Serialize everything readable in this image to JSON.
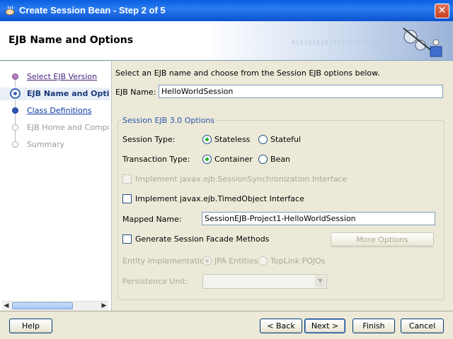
{
  "window": {
    "title": "Create Session Bean - Step 2 of 5"
  },
  "header": {
    "title": "EJB Name and Options",
    "binary_deco": "0101010101010101010101"
  },
  "steps": [
    {
      "label": "Select EJB Version",
      "state": "done"
    },
    {
      "label": "EJB Name and Options",
      "state": "current"
    },
    {
      "label": "Class Definitions",
      "state": "next"
    },
    {
      "label": "EJB Home and Component Interfaces",
      "state": "disabled"
    },
    {
      "label": "Summary",
      "state": "disabled"
    }
  ],
  "main": {
    "instructions": "Select an EJB name and choose from the Session EJB options below.",
    "ejb_name_label": "EJB Name:",
    "ejb_name_value": "HelloWorldSession",
    "group_title": "Session EJB 3.0 Options",
    "session_type_label": "Session Type:",
    "session_type_options": [
      "Stateless",
      "Stateful"
    ],
    "session_type_selected": "Stateless",
    "transaction_type_label": "Transaction Type:",
    "transaction_type_options": [
      "Container",
      "Bean"
    ],
    "transaction_type_selected": "Container",
    "implement_sync_label": "Implement javax.ejb.SessionSynchronization Interface",
    "implement_timed_label": "Implement javax.ejb.TimedObject Interface",
    "mapped_name_label": "Mapped Name:",
    "mapped_name_value": "SessionEJB-Project1-HelloWorldSession",
    "generate_facade_label": "Generate Session Facade Methods",
    "more_options_label": "More Options",
    "entity_impl_label": "Entity implementation:",
    "entity_impl_options": [
      "JPA Entities",
      "TopLink POJOs"
    ],
    "entity_impl_selected": "JPA Entities",
    "persistence_unit_label": "Persistence Unit:",
    "persistence_unit_value": ""
  },
  "buttons": {
    "help": "Help",
    "back": "< Back",
    "next": "Next >",
    "finish": "Finish",
    "cancel": "Cancel"
  }
}
